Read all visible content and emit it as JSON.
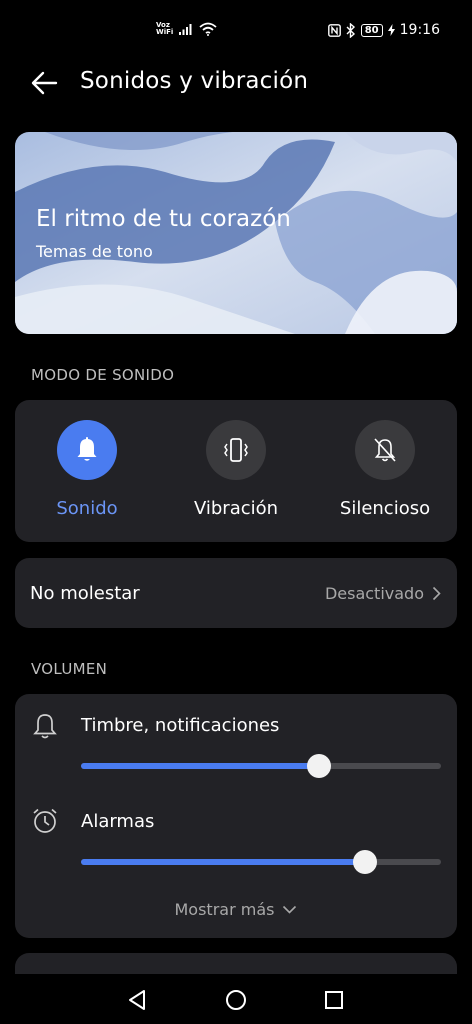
{
  "status_bar": {
    "voz_line1": "Voz",
    "voz_line2": "WiFi",
    "battery": "80",
    "time": "19:16"
  },
  "header": {
    "title": "Sonidos y vibración"
  },
  "banner": {
    "title": "El ritmo de tu corazón",
    "subtitle": "Temas de tono"
  },
  "sound_mode": {
    "section_label": "MODO DE SONIDO",
    "items": [
      {
        "label": "Sonido",
        "icon": "bell-icon",
        "active": true
      },
      {
        "label": "Vibración",
        "icon": "vibrate-icon",
        "active": false
      },
      {
        "label": "Silencioso",
        "icon": "bell-off-icon",
        "active": false
      }
    ]
  },
  "dnd": {
    "label": "No molestar",
    "value": "Desactivado"
  },
  "volume": {
    "section_label": "VOLUMEN",
    "items": [
      {
        "label": "Timbre, notificaciones",
        "icon": "bell-outline-icon",
        "level": 0.66
      },
      {
        "label": "Alarmas",
        "icon": "alarm-clock-icon",
        "level": 0.79
      }
    ],
    "show_more": "Mostrar más"
  },
  "colors": {
    "accent": "#4a7cf0",
    "card": "#222226",
    "background": "#000000"
  }
}
